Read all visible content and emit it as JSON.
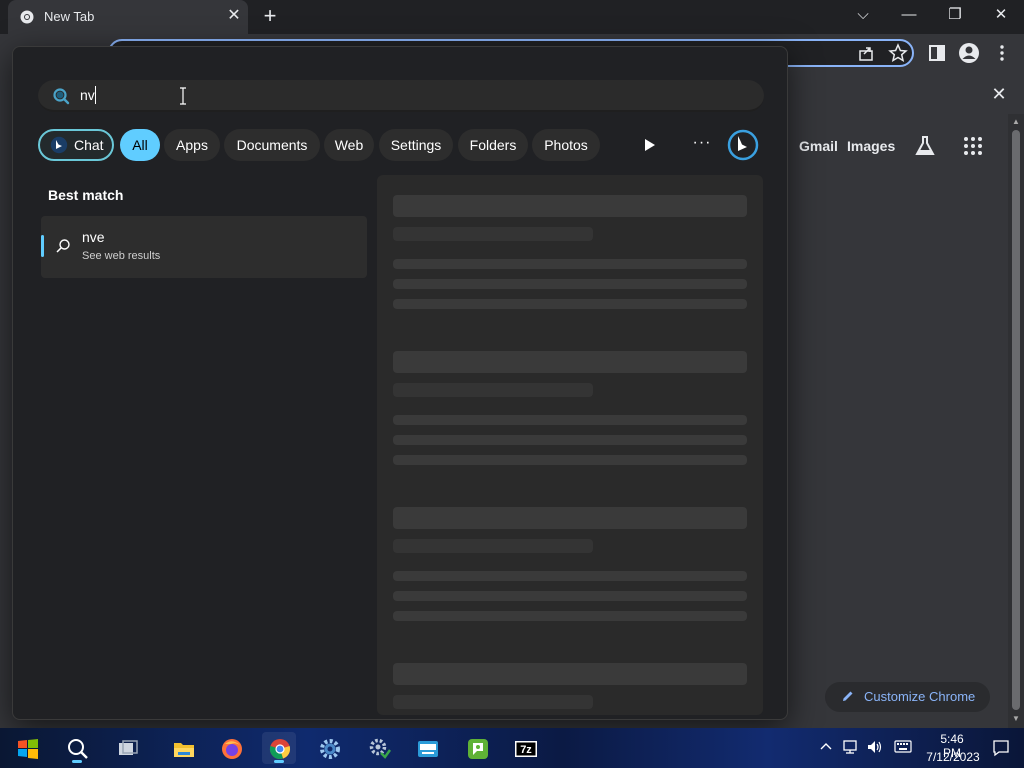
{
  "browser": {
    "tab_title": "New Tab",
    "tab_close_glyph": "✕",
    "new_tab_glyph": "+",
    "window_controls": {
      "dropdown": "⌵",
      "minimize": "—",
      "restore": "❐",
      "close": "✕"
    },
    "infobar_close_glyph": "✕",
    "ntp": {
      "gmail_label": "Gmail",
      "images_label": "Images",
      "customize_label": "Customize Chrome"
    }
  },
  "search_flyout": {
    "query": "nv",
    "filters": [
      "Chat",
      "All",
      "Apps",
      "Documents",
      "Web",
      "Settings",
      "Folders",
      "Photos"
    ],
    "active_filter": "All",
    "more_glyph": "···",
    "best_match_heading": "Best match",
    "result": {
      "title": "nve",
      "subtitle": "See web results"
    }
  },
  "taskbar": {
    "apps": [
      "start-icon",
      "search-icon",
      "task-view-icon",
      "file-explorer-icon",
      "firefox-icon",
      "chrome-icon",
      "settings-icon",
      "control-panel-icon",
      "keyboard-app-icon",
      "messaging-app-icon",
      "7zip-icon"
    ],
    "pinned_label_7zip": "7z",
    "clock": {
      "time": "5:46 PM",
      "date": "7/12/2023"
    }
  },
  "colors": {
    "accent": "#60cdff",
    "chrome_frame": "#202124",
    "chrome_surface": "#35363a",
    "link_blue": "#8ab4f8"
  }
}
